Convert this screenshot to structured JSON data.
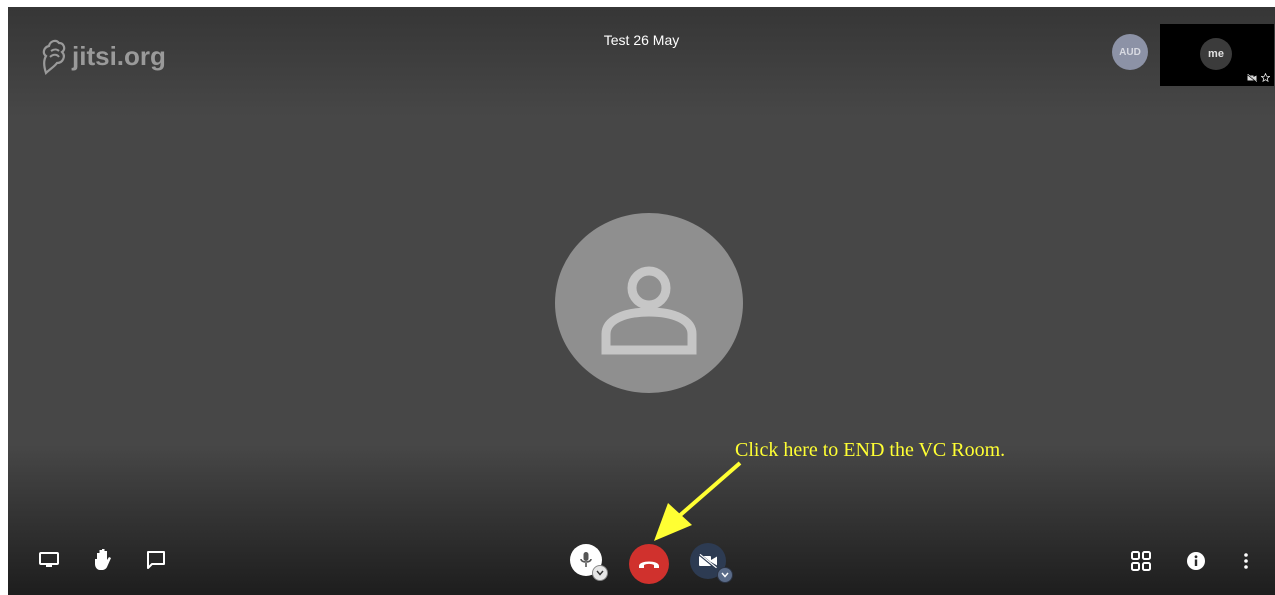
{
  "app": {
    "logo_text": "jitsi.org",
    "meeting_title": "Test 26 May"
  },
  "participants": {
    "remote_initials": "AUD",
    "local_initials": "me"
  },
  "annotation": {
    "text": "Click here to END the VC Room.",
    "color": "#ffff33"
  },
  "toolbar": {
    "left": [
      "screen-share-icon",
      "raise-hand-icon",
      "chat-icon"
    ],
    "center": [
      "microphone-icon",
      "hangup-icon",
      "camera-off-icon"
    ],
    "right": [
      "tile-view-icon",
      "info-icon",
      "more-options-icon"
    ],
    "hangup_color": "#d0312d"
  }
}
